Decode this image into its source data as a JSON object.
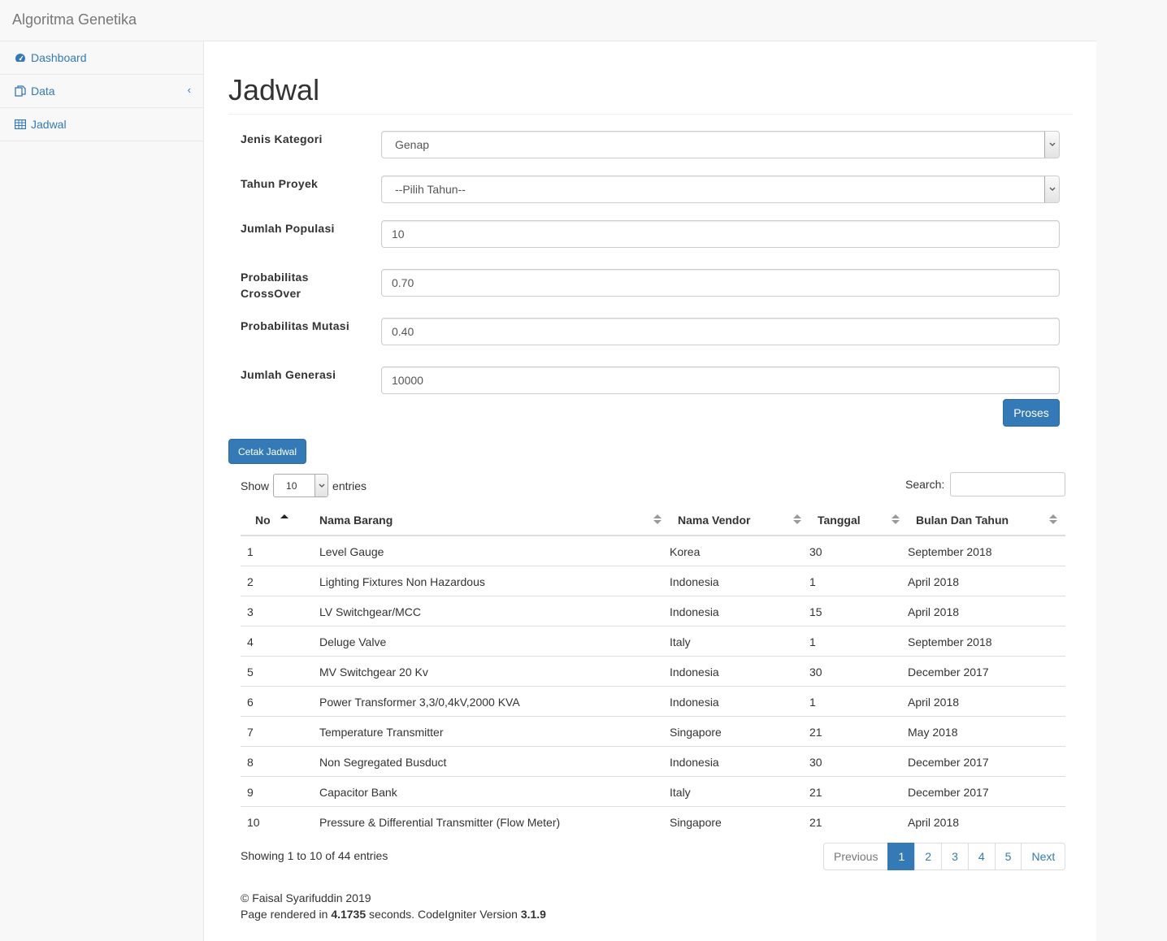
{
  "app": {
    "brand": "Algoritma Genetika"
  },
  "sidebar": {
    "items": [
      {
        "label": "Dashboard",
        "icon": "dashboard-icon"
      },
      {
        "label": "Data",
        "icon": "files-icon",
        "chevron": "‹"
      },
      {
        "label": "Jadwal",
        "icon": "table-icon"
      }
    ]
  },
  "page": {
    "title": "Jadwal"
  },
  "form": {
    "jenis_kategori": {
      "label": "Jenis Kategori",
      "value": "Genap"
    },
    "tahun_proyek": {
      "label": "Tahun Proyek",
      "value": "--Pilih Tahun--"
    },
    "jumlah_populasi": {
      "label": "Jumlah Populasi",
      "value": "10"
    },
    "prob_crossover": {
      "label_line1": "Probabilitas",
      "label_line2": "CrossOver",
      "value": "0.70"
    },
    "prob_mutasi": {
      "label": "Probabilitas Mutasi",
      "value": "0.40"
    },
    "jumlah_generasi": {
      "label": "Jumlah Generasi",
      "value": "10000"
    },
    "submit_label": "Proses"
  },
  "cetak_label": "Cetak Jadwal",
  "datatable": {
    "show_label": "Show",
    "entries_label": "entries",
    "page_length": "10",
    "search_label": "Search:",
    "columns": [
      "No",
      "Nama Barang",
      "Nama Vendor",
      "Tanggal",
      "Bulan Dan Tahun"
    ],
    "rows": [
      [
        "1",
        "Level Gauge",
        "Korea",
        "30",
        "September 2018"
      ],
      [
        "2",
        "Lighting Fixtures Non Hazardous",
        "Indonesia",
        "1",
        "April 2018"
      ],
      [
        "3",
        "LV Switchgear/MCC",
        "Indonesia",
        "15",
        "April 2018"
      ],
      [
        "4",
        "Deluge Valve",
        "Italy",
        "1",
        "September 2018"
      ],
      [
        "5",
        "MV Switchgear 20 Kv",
        "Indonesia",
        "30",
        "December 2017"
      ],
      [
        "6",
        "Power Transformer 3,3/0,4kV,2000 KVA",
        "Indonesia",
        "1",
        "April 2018"
      ],
      [
        "7",
        "Temperature Transmitter",
        "Singapore",
        "21",
        "May 2018"
      ],
      [
        "8",
        "Non Segregated Busduct",
        "Indonesia",
        "30",
        "December 2017"
      ],
      [
        "9",
        "Capacitor Bank",
        "Italy",
        "21",
        "December 2017"
      ],
      [
        "10",
        "Pressure & Differential Transmitter (Flow Meter)",
        "Singapore",
        "21",
        "April 2018"
      ]
    ],
    "info": "Showing 1 to 10 of 44 entries",
    "pagination": {
      "previous": "Previous",
      "pages": [
        "1",
        "2",
        "3",
        "4",
        "5"
      ],
      "next": "Next",
      "active_page": "1"
    }
  },
  "footer": {
    "copyright": "© Faisal Syarifuddin 2019",
    "rendered_prefix": "Page rendered in ",
    "rendered_time": "4.1735",
    "rendered_mid": " seconds. CodeIgniter Version ",
    "version": "3.1.9"
  }
}
